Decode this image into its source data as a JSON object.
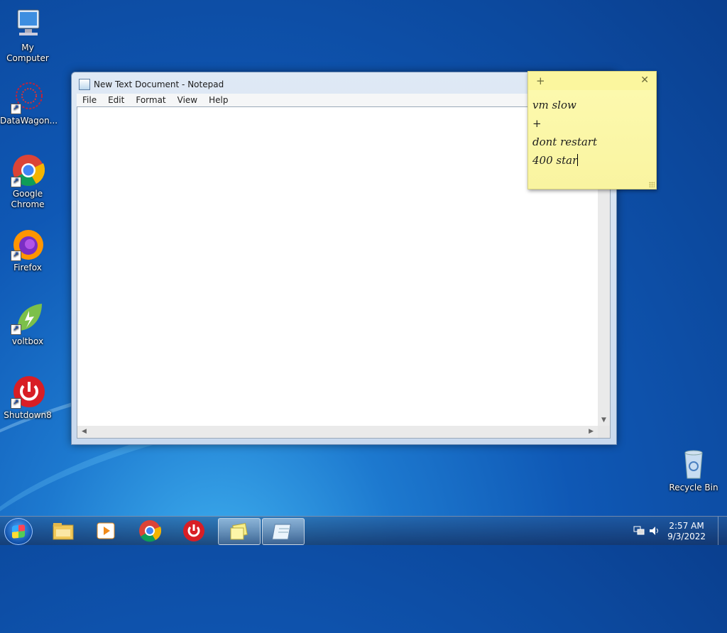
{
  "desktop": {
    "icons": [
      {
        "label": "My Computer"
      },
      {
        "label": "DataWagon..."
      },
      {
        "label": "Google Chrome"
      },
      {
        "label": "Firefox"
      },
      {
        "label": "voltbox"
      },
      {
        "label": "Shutdown8"
      }
    ],
    "recycle_bin": {
      "label": "Recycle Bin"
    }
  },
  "notepad": {
    "title": "New Text Document - Notepad",
    "menu": [
      "File",
      "Edit",
      "Format",
      "View",
      "Help"
    ],
    "content": ""
  },
  "sticky": {
    "lines": [
      "vm slow",
      "+",
      "dont restart",
      "400 star"
    ]
  },
  "taskbar": {
    "clock_time": "2:57 AM",
    "clock_date": "9/3/2022"
  }
}
